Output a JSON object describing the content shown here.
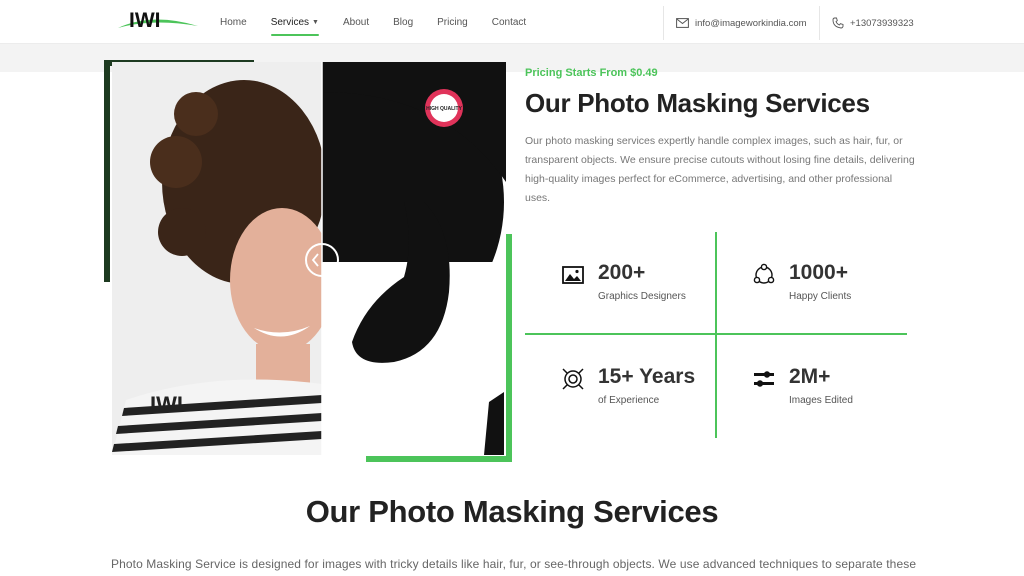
{
  "header": {
    "logo_text": "IWI",
    "nav": [
      {
        "label": "Home"
      },
      {
        "label": "Services",
        "active": true
      },
      {
        "label": "About"
      },
      {
        "label": "Blog"
      },
      {
        "label": "Pricing"
      },
      {
        "label": "Contact"
      }
    ],
    "email": "info@imageworkindia.com",
    "phone": "+13073939323",
    "email_icon": "mail-icon",
    "phone_icon": "phone-icon"
  },
  "hero": {
    "price_tag": "Pricing Starts From $0.49",
    "title": "Our Photo Masking Services",
    "description": "Our photo masking services expertly handle complex images, such as hair, fur, or transparent objects. We ensure precise cutouts without losing fine details, delivering high-quality images perfect for eCommerce, advertising, and other professional uses.",
    "badge_text": "HIGH QUALITY",
    "watermark": "IWI"
  },
  "stats": [
    {
      "icon": "image-icon",
      "value": "200+",
      "label": "Graphics Designers"
    },
    {
      "icon": "clients-icon",
      "value": "1000+",
      "label": "Happy Clients"
    },
    {
      "icon": "target-icon",
      "value": "15+ Years",
      "label": "of Experience"
    },
    {
      "icon": "sliders-icon",
      "value": "2M+",
      "label": "Images Edited"
    }
  ],
  "section": {
    "title": "Our Photo Masking Services",
    "description": "Photo Masking Service is designed for images with tricky details like hair, fur, or see-through objects. We use advanced techniques to separate these"
  },
  "colors": {
    "accent": "#4cc45a",
    "text_dark": "#222222",
    "text_muted": "#777777"
  }
}
